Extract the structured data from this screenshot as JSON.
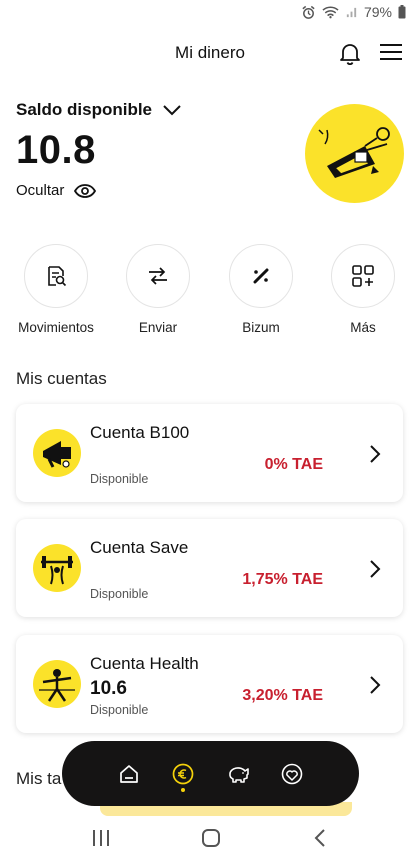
{
  "status_bar": {
    "battery": "79%"
  },
  "header": {
    "title": "Mi dinero"
  },
  "balance": {
    "label": "Saldo disponible",
    "amount": "10.8",
    "hide_label": "Ocultar"
  },
  "actions": [
    {
      "label": "Movimientos",
      "icon": "document-search-icon"
    },
    {
      "label": "Enviar",
      "icon": "transfer-arrows-icon"
    },
    {
      "label": "Bizum",
      "icon": "bizum-icon"
    },
    {
      "label": "Más",
      "icon": "grid-plus-icon"
    }
  ],
  "accounts_section": {
    "title": "Mis cuentas"
  },
  "accounts": [
    {
      "name": "Cuenta B100",
      "amount": "",
      "sub": "Disponible",
      "tae": "0% TAE"
    },
    {
      "name": "Cuenta Save",
      "amount": "",
      "sub": "Disponible",
      "tae": "1,75% TAE"
    },
    {
      "name": "Cuenta Health",
      "amount": "10.6",
      "sub": "Disponible",
      "tae": "3,20% TAE"
    }
  ],
  "next_section": {
    "title_partial": "Mis ta"
  },
  "bottom_nav": {
    "items": [
      "home-icon",
      "euro-icon",
      "piggy-bank-icon",
      "heart-globe-icon"
    ],
    "active": "euro-icon"
  },
  "colors": {
    "brand_yellow": "#fbe22a",
    "tae_red": "#c8202f",
    "nav_dark": "#151414"
  }
}
